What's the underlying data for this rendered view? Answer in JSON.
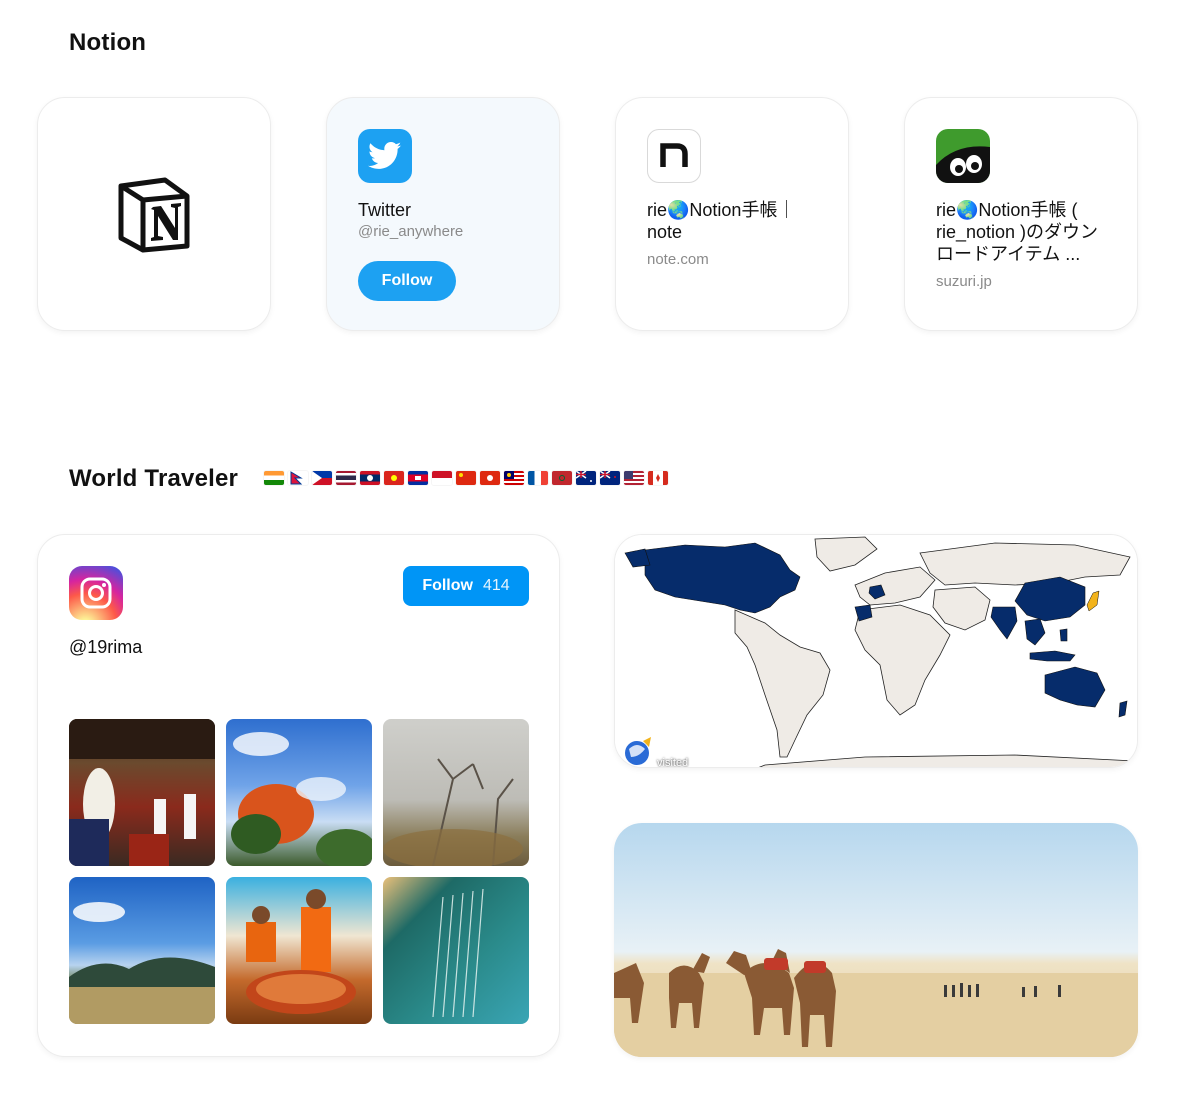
{
  "sections": {
    "notion_title": "Notion",
    "world_title": "World Traveler"
  },
  "flags": [
    "in",
    "np",
    "ph",
    "th",
    "la",
    "vn",
    "kh",
    "id",
    "cn",
    "hk",
    "my",
    "fr",
    "ma",
    "au",
    "nz",
    "us",
    "ca"
  ],
  "cards": {
    "notion": {
      "icon": "notion-logo"
    },
    "twitter": {
      "icon": "twitter-bird-icon",
      "name": "Twitter",
      "handle": "@rie_anywhere",
      "follow_label": "Follow",
      "accent": "#1da1f2"
    },
    "note": {
      "icon": "note-logo",
      "title": "rie🌏Notion手帳｜note",
      "domain": "note.com"
    },
    "suzuri": {
      "icon": "suzuri-logo",
      "title": "rie🌏Notion手帳 ( rie_notion )のダウンロードアイテム ...",
      "domain": "suzuri.jp"
    }
  },
  "instagram": {
    "icon": "instagram-icon",
    "handle": "@19rima",
    "follow_label": "Follow",
    "follower_count": "414",
    "accent": "#0095f6",
    "photos": [
      "restaurant-photo",
      "autumn-tree-photo",
      "foggy-forest-photo",
      "mountain-field-photo",
      "street-food-photo",
      "book-page-photo"
    ]
  },
  "map": {
    "legend_label": "visited",
    "visited_color": "#062c6b",
    "land_color": "#efebe6"
  },
  "camel_photo": {
    "icon": "camel-desert-photo"
  }
}
